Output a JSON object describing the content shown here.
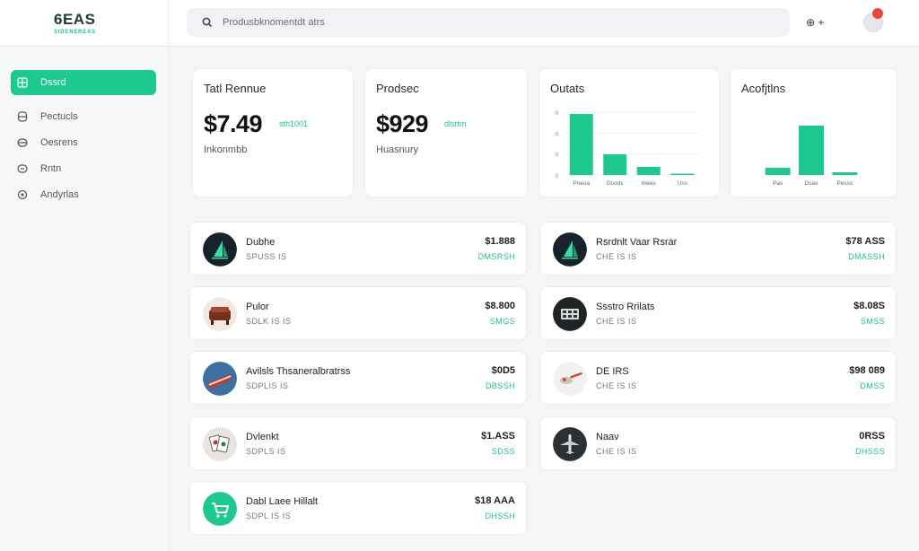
{
  "brand": {
    "name": "6EAS",
    "tagline": "SIDENEREAS",
    "accent": "#1dc98f",
    "alert": "#e8473a"
  },
  "search": {
    "placeholder": "Produsbknomentdt atrs"
  },
  "header": {
    "action_label": "⊕ +",
    "avatar_icon": "user-avatar-icon"
  },
  "sidebar": {
    "items": [
      {
        "label": "Dssrd",
        "icon": "dashboard-icon",
        "active": true
      },
      {
        "label": "Pectucls",
        "icon": "products-icon",
        "active": false
      },
      {
        "label": "Oesrens",
        "icon": "orders-icon",
        "active": false
      },
      {
        "label": "Rntn",
        "icon": "reports-icon",
        "active": false
      },
      {
        "label": "Andyrlas",
        "icon": "analytics-icon",
        "active": false
      }
    ]
  },
  "stats": [
    {
      "title": "Tatl Rennue",
      "value": "$7.49",
      "trend": "sth1001",
      "foot": "Inkonmbb"
    },
    {
      "title": "Prodsec",
      "value": "$929",
      "trend": "dlsrtm",
      "foot": "Huasnury"
    }
  ],
  "charts": [
    {
      "title": "Outats",
      "chart_data": {
        "type": "bar",
        "categories": [
          "Pneoa",
          "Dsods",
          "Inees",
          "Uss"
        ],
        "values": [
          68,
          23,
          9,
          1
        ],
        "ylim": [
          0,
          70
        ],
        "y_ticks": [
          "0",
          "0",
          "0",
          "0"
        ],
        "grid": true,
        "color": "#1dc98f"
      }
    },
    {
      "title": "Acofjtlns",
      "chart_data": {
        "type": "bar",
        "categories": [
          "Pas",
          "Dsas",
          "Pesss"
        ],
        "values": [
          8,
          55,
          3
        ],
        "ylim": [
          0,
          70
        ],
        "grid": false,
        "color": "#1dc98f"
      }
    }
  ],
  "products": [
    {
      "name": "Dubhe",
      "sub": "SPUSS IS",
      "price": "$1.888",
      "status": "DMSRSH",
      "thumb": "sail-logo-icon"
    },
    {
      "name": "Rsrdnlt Vaar Rsrar",
      "sub": "CHE IS IS",
      "price": "$78 ASS",
      "status": "DMASSH",
      "thumb": "sail-logo-icon"
    },
    {
      "name": "Pulor",
      "sub": "SDLK IS IS",
      "price": "$8.800",
      "status": "SMGS",
      "thumb": "furniture-photo-icon"
    },
    {
      "name": "Ssstro Rrilats",
      "sub": "CHE IS IS",
      "price": "$8.08S",
      "status": "SMSS",
      "thumb": "grid-badge-icon"
    },
    {
      "name": "Avilsls Thsaneralbratrss",
      "sub": "SDPLIS IS",
      "price": "$0D5",
      "status": "DBSSH",
      "thumb": "flag-photo-icon"
    },
    {
      "name": "DE IRS",
      "sub": "CHE IS IS",
      "price": "$98 089",
      "status": "DMSS",
      "thumb": "spoon-photo-icon"
    },
    {
      "name": "Dvlenkt",
      "sub": "SDPLS IS",
      "price": "$1.ASS",
      "status": "SDSS",
      "thumb": "cards-photo-icon"
    },
    {
      "name": "Naav",
      "sub": "CHE IS IS",
      "price": "0RSS",
      "status": "DHSSS",
      "thumb": "plane-photo-icon"
    },
    {
      "name": "Dabl Laee Hillalt",
      "sub": "SDPL IS IS",
      "price": "$18 AAA",
      "status": "DHSSH",
      "thumb": "cart-icon"
    }
  ]
}
